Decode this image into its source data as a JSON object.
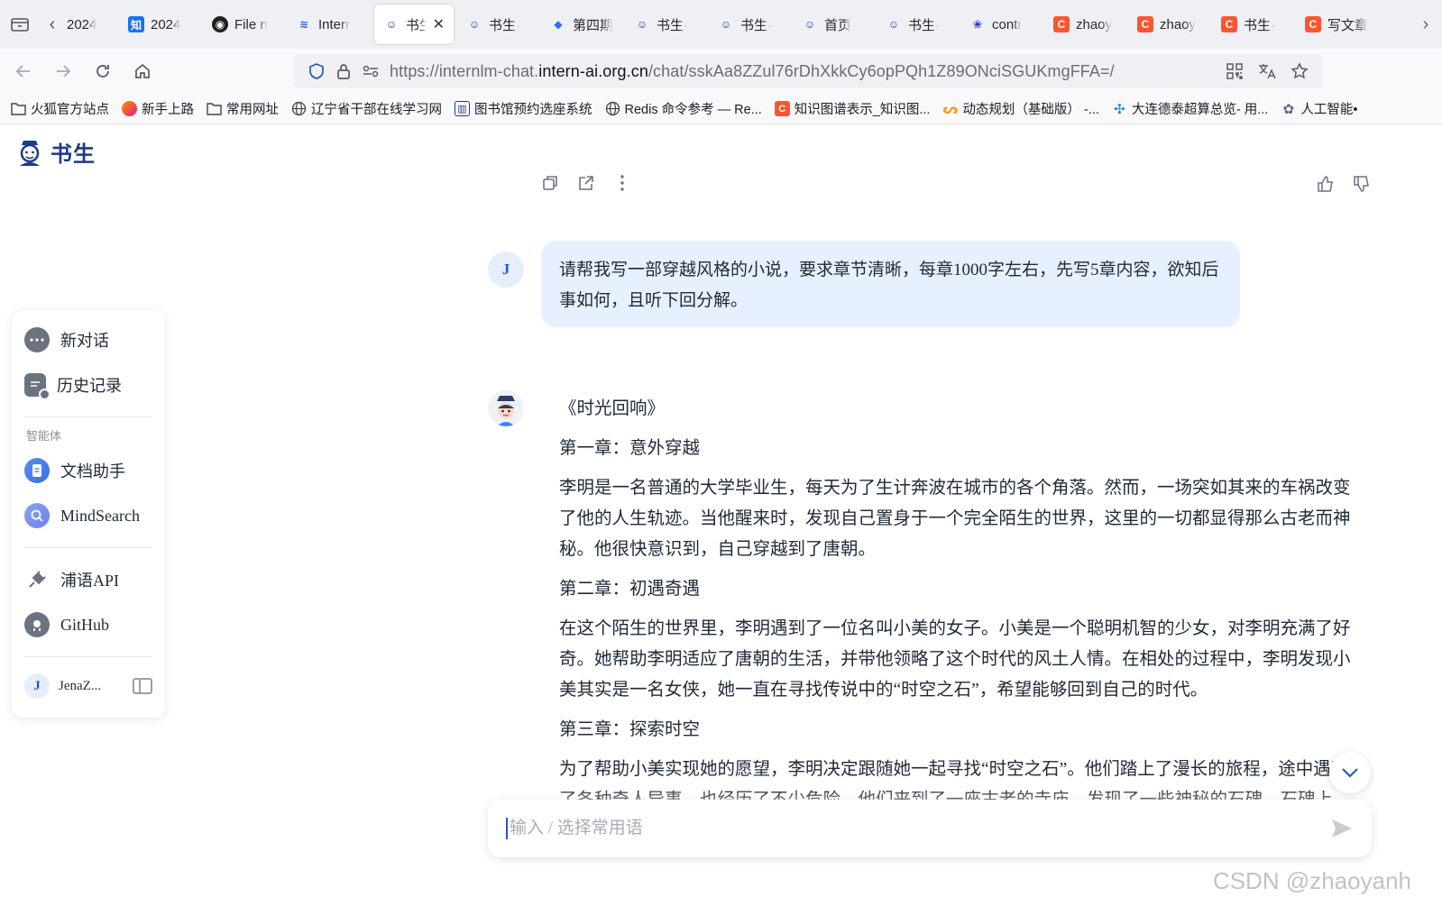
{
  "tabs": [
    {
      "title": "2024",
      "favicon": "chevron-left-prefix",
      "color": "#555555"
    },
    {
      "title": "2024",
      "favicon": "zhihu-icon",
      "color": "#1772f6",
      "glyph": "知"
    },
    {
      "title": "File n",
      "favicon": "github-icon",
      "color": "#1f1f1f"
    },
    {
      "title": "Interr",
      "favicon": "internlm-icon",
      "color": "#3b5bdb"
    },
    {
      "title": "书生",
      "favicon": "shusheng-icon",
      "color": "#1e3a8a",
      "active": true
    },
    {
      "title": "书生·",
      "favicon": "shusheng-icon",
      "color": "#1e3a8a"
    },
    {
      "title": "第四期",
      "favicon": "feishu-icon",
      "color": "#2f6bff"
    },
    {
      "title": "书生·",
      "favicon": "shusheng-icon",
      "color": "#1e3a8a"
    },
    {
      "title": "书生·",
      "favicon": "shusheng-icon",
      "color": "#1e3a8a"
    },
    {
      "title": "首页",
      "favicon": "shusheng-icon",
      "color": "#1e3a8a"
    },
    {
      "title": "书生·",
      "favicon": "shusheng-icon",
      "color": "#1e3a8a"
    },
    {
      "title": "contr",
      "favicon": "baidu-icon",
      "color": "#2932e1"
    },
    {
      "title": "zhaoy",
      "favicon": "csdn-icon",
      "color": "#fc5531",
      "glyph": "C"
    },
    {
      "title": "zhaoy",
      "favicon": "csdn-icon",
      "color": "#fc5531",
      "glyph": "C"
    },
    {
      "title": "书生·",
      "favicon": "csdn-icon",
      "color": "#fc5531",
      "glyph": "C"
    },
    {
      "title": "写文章",
      "favicon": "csdn-icon",
      "color": "#fc5531",
      "glyph": "C"
    }
  ],
  "url": {
    "prefix": "https://internlm-chat.",
    "domain": "intern-ai.org.cn",
    "suffix": "/chat/sskAa8ZZul76rDhXkkCy6opPQh1Z89ONciSGUKmgFFA=/"
  },
  "bookmarks": [
    {
      "label": "火狐官方站点",
      "icon": "folder-icon"
    },
    {
      "label": "新手上路",
      "icon": "firefox-icon"
    },
    {
      "label": "常用网址",
      "icon": "folder-icon"
    },
    {
      "label": "辽宁省干部在线学习网",
      "icon": "globe-icon"
    },
    {
      "label": "图书馆预约选座系统",
      "icon": "library-icon"
    },
    {
      "label": "Redis 命令参考 — Re...",
      "icon": "globe-icon"
    },
    {
      "label": "知识图谱表示_知识图...",
      "icon": "csdn-icon"
    },
    {
      "label": "动态规划（基础版） -...",
      "icon": "leetcode-icon"
    },
    {
      "label": "大连德泰超算总览- 用...",
      "icon": "cluster-icon"
    },
    {
      "label": "人工智能•",
      "icon": "ai-icon"
    }
  ],
  "brand": {
    "name": "书生"
  },
  "sidebar": {
    "new_chat": "新对话",
    "history": "历史记录",
    "section_agents": "智能体",
    "doc_assistant": "文档助手",
    "mindsearch": "MindSearch",
    "api": "浦语API",
    "github": "GitHub",
    "user_initial": "J",
    "user_name": "JenaZ..."
  },
  "conversation": {
    "user_initial": "J",
    "user_message": "请帮我写一部穿越风格的小说，要求章节清晰，每章1000字左右，先写5章内容，欲知后事如何，且听下回分解。",
    "reply": [
      "《时光回响》",
      "第一章：意外穿越",
      "李明是一名普通的大学毕业生，每天为了生计奔波在城市的各个角落。然而，一场突如其来的车祸改变了他的人生轨迹。当他醒来时，发现自己置身于一个完全陌生的世界，这里的一切都显得那么古老而神秘。他很快意识到，自己穿越到了唐朝。",
      "第二章：初遇奇遇",
      "在这个陌生的世界里，李明遇到了一位名叫小美的女子。小美是一个聪明机智的少女，对李明充满了好奇。她帮助李明适应了唐朝的生活，并带他领略了这个时代的风土人情。在相处的过程中，李明发现小美其实是一名女侠，她一直在寻找传说中的“时空之石”，希望能够回到自己的时代。",
      "第三章：探索时空",
      "为了帮助小美实现她的愿望，李明决定跟随她一起寻找“时空之石”。他们踏上了漫长的旅程，途中遇到了各种奇人异事，也经历了不少危险。他们来到了一座古老的寺庙，发现了一些神秘的石碑，石碑上"
    ]
  },
  "composer": {
    "placeholder": "输入 / 选择常用语"
  },
  "watermark": "CSDN @zhaoyanh"
}
